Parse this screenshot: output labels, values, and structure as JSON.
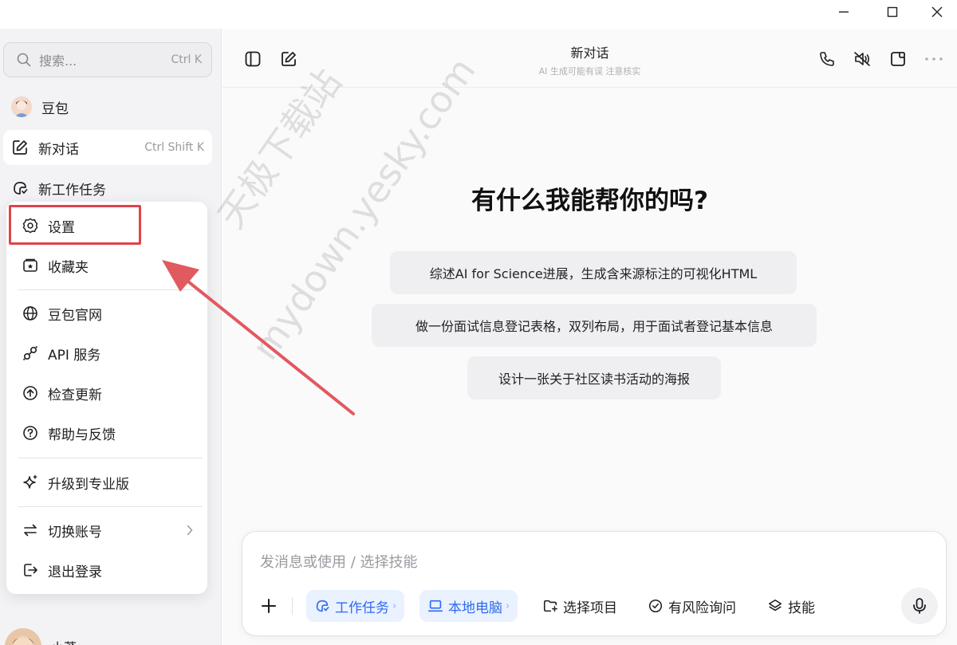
{
  "window": {
    "controls": [
      "minimize-icon",
      "maximize-icon",
      "close-icon"
    ]
  },
  "sidebar": {
    "search": {
      "placeholder": "搜索...",
      "shortcut": "Ctrl K"
    },
    "items": [
      {
        "label": "豆包",
        "icon": "doubao-avatar-icon"
      },
      {
        "label": "新对话",
        "shortcut": "Ctrl Shift K",
        "icon": "new-chat-icon"
      },
      {
        "label": "新工作任务",
        "icon": "task-icon"
      }
    ],
    "user": {
      "name": "小莽",
      "chevron": "›"
    }
  },
  "menu": {
    "items": [
      {
        "label": "设置",
        "icon": "gear-icon"
      },
      {
        "label": "收藏夹",
        "icon": "favorites-icon"
      },
      {
        "label": "豆包官网",
        "icon": "globe-icon"
      },
      {
        "label": "API 服务",
        "icon": "api-icon"
      },
      {
        "label": "检查更新",
        "icon": "update-icon"
      },
      {
        "label": "帮助与反馈",
        "icon": "help-icon"
      },
      {
        "label": "升级到专业版",
        "icon": "sparkle-icon"
      },
      {
        "label": "切换账号",
        "icon": "switch-icon"
      },
      {
        "label": "退出登录",
        "icon": "logout-icon"
      }
    ]
  },
  "header": {
    "title": "新对话",
    "subtitle": "AI 生成可能有误 注意核实"
  },
  "main": {
    "heading": "有什么我能帮你的吗?",
    "suggestions": [
      "综述AI for Science进展，生成含来源标注的可视化HTML",
      "做一份面试信息登记表格，双列布局，用于面试者登记基本信息",
      "设计一张关于社区读书活动的海报"
    ]
  },
  "composer": {
    "placeholder": "发消息或使用 / 选择技能",
    "tools": [
      "工作任务",
      "本地电脑",
      "选择项目",
      "有风险询问",
      "技能"
    ]
  },
  "watermark": {
    "line1": "天极下载站",
    "line2": "mydown.yesky.com"
  },
  "colors": {
    "accent": "#2b6bf0",
    "highlight": "#e0434a",
    "arrow": "#e05a5f"
  }
}
